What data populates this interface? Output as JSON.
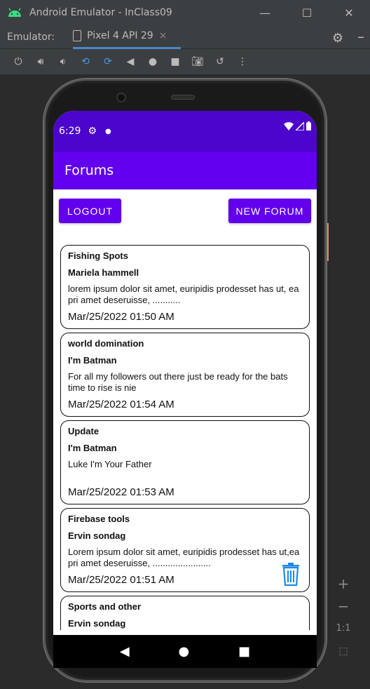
{
  "window": {
    "title": "Android Emulator - InClass09"
  },
  "tabbar": {
    "label": "Emulator:",
    "tab_name": "Pixel 4 API 29",
    "tab_close": "×"
  },
  "statusbar": {
    "time": "6:29"
  },
  "app": {
    "title": "Forums",
    "logout_label": "LOGOUT",
    "new_forum_label": "NEW FORUM"
  },
  "forums": [
    {
      "title": "Fishing Spots",
      "author": "Mariela hammell",
      "body": "lorem ipsum dolor sit amet, euripidis prodesset has ut, ea pri amet deseruisse, ...........",
      "date": "Mar/25/2022 01:50 AM"
    },
    {
      "title": "world domination",
      "author": "I'm Batman",
      "body": "For all my followers out there just be ready for the bats time to rise is nie",
      "date": "Mar/25/2022 01:54 AM"
    },
    {
      "title": "Update",
      "author": "I'm Batman",
      "body": "Luke I'm Your Father",
      "date": "Mar/25/2022 01:53 AM"
    },
    {
      "title": "Firebase tools",
      "author": "Ervin sondag",
      "body": "Lorem ipsum dolor sit amet, euripidis prodesset has ut,ea pri amet deseruisse, .......................",
      "date": "Mar/25/2022 01:51 AM"
    },
    {
      "title": "Sports and other",
      "author": "Ervin sondag",
      "body": "",
      "date": ""
    }
  ],
  "zoom": {
    "plus": "+",
    "minus": "−",
    "ratio": "1:1"
  },
  "colors": {
    "primary": "#6200ee",
    "primary_dark": "#4c05cc",
    "trash": "#1e88e5"
  }
}
